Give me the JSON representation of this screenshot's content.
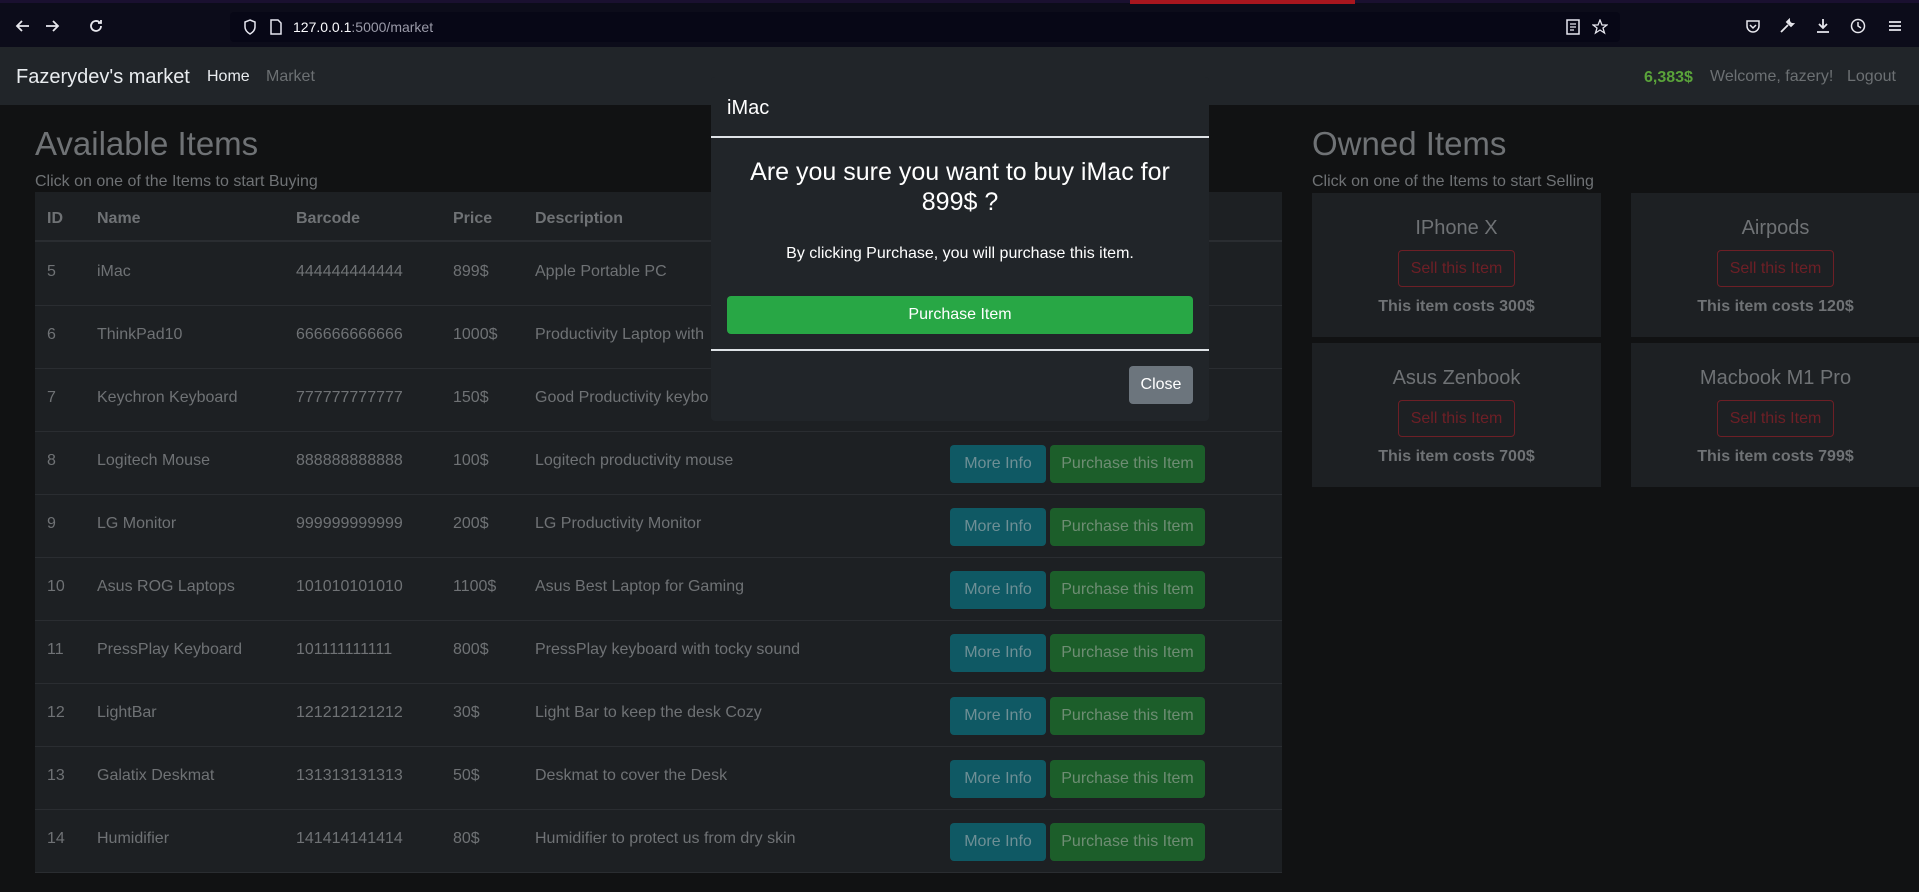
{
  "browser": {
    "url_host": "127.0.0.1",
    "url_path": ":5000/market"
  },
  "navbar": {
    "brand": "Fazerydev's market",
    "home": "Home",
    "market": "Market",
    "budget": "6,383$",
    "welcome": "Welcome, fazery!",
    "logout": "Logout"
  },
  "available": {
    "title": "Available Items",
    "subtitle": "Click on one of the Items to start Buying",
    "headers": [
      "ID",
      "Name",
      "Barcode",
      "Price",
      "Description"
    ],
    "more_info_label": "More Info",
    "purchase_label": "Purchase this Item",
    "rows": [
      {
        "id": "5",
        "name": "iMac",
        "barcode": "444444444444",
        "price": "899$",
        "description": "Apple Portable PC"
      },
      {
        "id": "6",
        "name": "ThinkPad10",
        "barcode": "666666666666",
        "price": "1000$",
        "description": "Productivity Laptop with"
      },
      {
        "id": "7",
        "name": "Keychron Keyboard",
        "barcode": "777777777777",
        "price": "150$",
        "description": "Good Productivity keybo"
      },
      {
        "id": "8",
        "name": "Logitech Mouse",
        "barcode": "888888888888",
        "price": "100$",
        "description": "Logitech productivity mouse"
      },
      {
        "id": "9",
        "name": "LG Monitor",
        "barcode": "999999999999",
        "price": "200$",
        "description": "LG Productivity Monitor"
      },
      {
        "id": "10",
        "name": "Asus ROG Laptops",
        "barcode": "101010101010",
        "price": "1100$",
        "description": "Asus Best Laptop for Gaming"
      },
      {
        "id": "11",
        "name": "PressPlay Keyboard",
        "barcode": "101111111111",
        "price": "800$",
        "description": "PressPlay keyboard with tocky sound"
      },
      {
        "id": "12",
        "name": "LightBar",
        "barcode": "121212121212",
        "price": "30$",
        "description": "Light Bar to keep the desk Cozy"
      },
      {
        "id": "13",
        "name": "Galatix Deskmat",
        "barcode": "131313131313",
        "price": "50$",
        "description": "Deskmat to cover the Desk"
      },
      {
        "id": "14",
        "name": "Humidifier",
        "barcode": "141414141414",
        "price": "80$",
        "description": "Humidifier to protect us from dry skin"
      }
    ]
  },
  "owned": {
    "title": "Owned Items",
    "subtitle": "Click on one of the Items to start Selling",
    "sell_label": "Sell this Item",
    "items": [
      {
        "name": "IPhone X",
        "cost": "This item costs 300$"
      },
      {
        "name": "Airpods",
        "cost": "This item costs 120$"
      },
      {
        "name": "Asus Zenbook",
        "cost": "This item costs 700$"
      },
      {
        "name": "Macbook M1 Pro",
        "cost": "This item costs 799$"
      }
    ]
  },
  "modal": {
    "title": "iMac",
    "question": "Are you sure you want to buy iMac for 899$ ?",
    "note": "By clicking Purchase, you will purchase this item.",
    "purchase": "Purchase Item",
    "close": "Close"
  },
  "colors": {
    "budget": "#5aa33a",
    "purchase": "#28a745",
    "info": "#17a2b8",
    "danger": "#dc3545"
  }
}
